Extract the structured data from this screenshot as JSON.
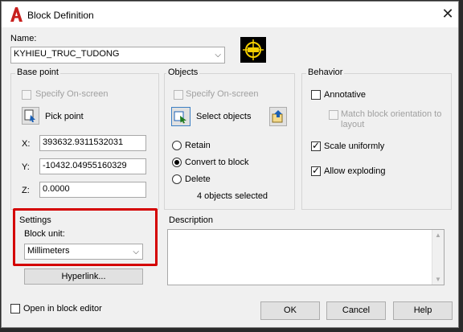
{
  "window": {
    "title": "Block Definition",
    "close_glyph": "✕"
  },
  "name": {
    "label": "Name:",
    "value": "KYHIEU_TRUC_TUDONG"
  },
  "base_point": {
    "title": "Base point",
    "specify_on_screen": "Specify On-screen",
    "pick_point": "Pick point",
    "x_label": "X:",
    "x_value": "393632.9311532031",
    "y_label": "Y:",
    "y_value": "-10432.04955160329",
    "z_label": "Z:",
    "z_value": "0.0000"
  },
  "objects": {
    "title": "Objects",
    "specify_on_screen": "Specify On-screen",
    "select_objects": "Select objects",
    "retain": "Retain",
    "convert": "Convert to block",
    "delete": "Delete",
    "selected_count": "4 objects selected",
    "selected_mode": "convert"
  },
  "behavior": {
    "title": "Behavior",
    "annotative": "Annotative",
    "match_orientation": "Match block orientation to layout",
    "scale_uniformly": "Scale uniformly",
    "allow_exploding": "Allow exploding",
    "annotative_checked": false,
    "scale_uniformly_checked": true,
    "allow_exploding_checked": true
  },
  "settings": {
    "title": "Settings",
    "block_unit_label": "Block unit:",
    "block_unit_value": "Millimeters",
    "hyperlink": "Hyperlink..."
  },
  "description": {
    "title": "Description",
    "value": ""
  },
  "footer": {
    "open_in_editor": "Open in block editor",
    "ok": "OK",
    "cancel": "Cancel",
    "help": "Help"
  },
  "colors": {
    "highlight": "#d40000",
    "app_icon": "#c8201e"
  }
}
